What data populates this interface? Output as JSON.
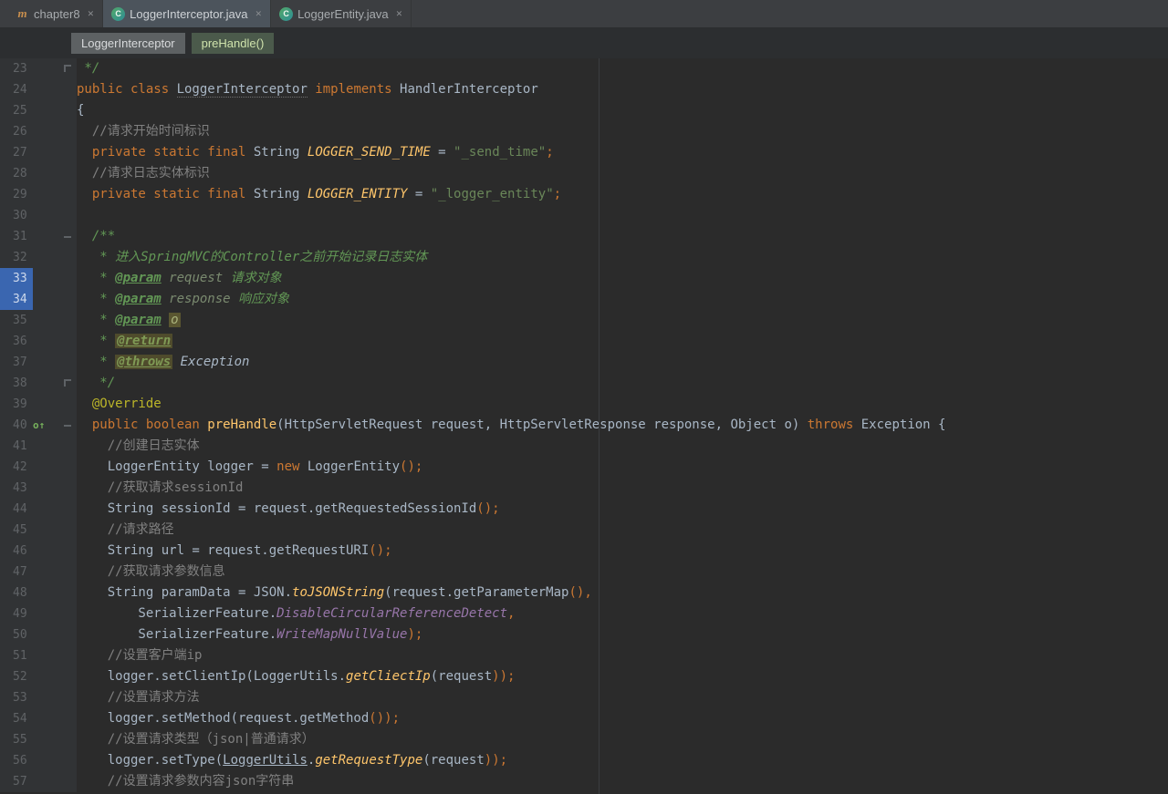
{
  "colors": {
    "editor_bg": "#2b2b2b",
    "gutter_bg": "#313335",
    "tabbar_bg": "#3c3e41",
    "selected_tab_bg": "#4c545c",
    "keyword": "#cc7832",
    "string": "#6a8759",
    "comment": "#808080",
    "javadoc": "#629755",
    "constant": "#ffc66b",
    "static_field": "#9876aa",
    "bookmark_blue": "#3a66b0"
  },
  "tabs": [
    {
      "label": "chapter8",
      "icon": "module",
      "selected": false,
      "close_icon": "x"
    },
    {
      "label": "LoggerInterceptor.java",
      "icon": "class",
      "selected": true,
      "close_icon": "x"
    },
    {
      "label": "LoggerEntity.java",
      "icon": "class",
      "selected": false,
      "close_icon": "x"
    }
  ],
  "breadcrumbs": [
    {
      "label": "LoggerInterceptor",
      "type": "class"
    },
    {
      "label": "preHandle()",
      "type": "method"
    }
  ],
  "editor": {
    "first_line": 23,
    "last_line": 57,
    "lines": [
      {
        "n": 23,
        "fold": "end",
        "seg": [
          [
            "d",
            " */"
          ]
        ]
      },
      {
        "n": 24,
        "seg": [
          [
            "k",
            "public class "
          ],
          [
            "spell",
            "LoggerInterceptor"
          ],
          [
            "k",
            " implements "
          ],
          [
            "p",
            "HandlerInterceptor"
          ]
        ]
      },
      {
        "n": 25,
        "seg": [
          [
            "p",
            "{"
          ]
        ]
      },
      {
        "n": 26,
        "seg": [
          [
            "c",
            "  //请求开始时间标识"
          ]
        ]
      },
      {
        "n": 27,
        "seg": [
          [
            "k",
            "  private static final "
          ],
          [
            "p",
            "String "
          ],
          [
            "cn",
            "LOGGER_SEND_TIME"
          ],
          [
            "p",
            " = "
          ],
          [
            "s",
            "\"_send_time\""
          ],
          [
            "pu",
            ";"
          ]
        ]
      },
      {
        "n": 28,
        "seg": [
          [
            "c",
            "  //请求日志实体标识"
          ]
        ]
      },
      {
        "n": 29,
        "seg": [
          [
            "k",
            "  private static final "
          ],
          [
            "p",
            "String "
          ],
          [
            "cn",
            "LOGGER_ENTITY"
          ],
          [
            "p",
            " = "
          ],
          [
            "s",
            "\"_logger_entity\""
          ],
          [
            "pu",
            ";"
          ]
        ]
      },
      {
        "n": 30,
        "seg": []
      },
      {
        "n": 31,
        "fold": "start",
        "seg": [
          [
            "d",
            "  /**"
          ]
        ]
      },
      {
        "n": 32,
        "seg": [
          [
            "d",
            "   * 进入SpringMVC的Controller之前开始记录日志实体"
          ]
        ]
      },
      {
        "n": 33,
        "mark": true,
        "seg": [
          [
            "d",
            "   * "
          ],
          [
            "dt",
            "@param"
          ],
          [
            "dv",
            " request "
          ],
          [
            "d",
            "请求对象"
          ]
        ]
      },
      {
        "n": 34,
        "mark": true,
        "seg": [
          [
            "d",
            "   * "
          ],
          [
            "dt",
            "@param"
          ],
          [
            "dv",
            " response "
          ],
          [
            "d",
            "响应对象"
          ]
        ]
      },
      {
        "n": 35,
        "seg": [
          [
            "d",
            "   * "
          ],
          [
            "dt",
            "@param"
          ],
          [
            "d",
            " "
          ],
          [
            "hl",
            "o"
          ]
        ]
      },
      {
        "n": 36,
        "seg": [
          [
            "d",
            "   * "
          ],
          [
            "dtbg",
            "@return"
          ]
        ]
      },
      {
        "n": 37,
        "seg": [
          [
            "d",
            "   * "
          ],
          [
            "dtbg",
            "@throws"
          ],
          [
            "dve",
            " Exception"
          ]
        ]
      },
      {
        "n": 38,
        "fold": "end",
        "seg": [
          [
            "d",
            "   */"
          ]
        ]
      },
      {
        "n": 39,
        "seg": [
          [
            "an",
            "  @Override"
          ]
        ]
      },
      {
        "n": 40,
        "fold": "start",
        "override": true,
        "seg": [
          [
            "k",
            "  public boolean "
          ],
          [
            "m",
            "preHandle"
          ],
          [
            "p",
            "(HttpServletRequest request, HttpServletResponse response, Object o) "
          ],
          [
            "k",
            "throws"
          ],
          [
            "p",
            " Exception {"
          ]
        ]
      },
      {
        "n": 41,
        "seg": [
          [
            "c",
            "    //创建日志实体"
          ]
        ]
      },
      {
        "n": 42,
        "seg": [
          [
            "p",
            "    LoggerEntity logger = "
          ],
          [
            "k",
            "new"
          ],
          [
            "p",
            " LoggerEntity"
          ],
          [
            "pu",
            "();"
          ]
        ]
      },
      {
        "n": 43,
        "seg": [
          [
            "c",
            "    //获取请求sessionId"
          ]
        ]
      },
      {
        "n": 44,
        "seg": [
          [
            "p",
            "    String sessionId = request.getRequestedSessionId"
          ],
          [
            "pu",
            "();"
          ]
        ]
      },
      {
        "n": 45,
        "seg": [
          [
            "c",
            "    //请求路径"
          ]
        ]
      },
      {
        "n": 46,
        "seg": [
          [
            "p",
            "    String url = request.getRequestURI"
          ],
          [
            "pu",
            "();"
          ]
        ]
      },
      {
        "n": 47,
        "seg": [
          [
            "c",
            "    //获取请求参数信息"
          ]
        ]
      },
      {
        "n": 48,
        "seg": [
          [
            "p",
            "    String paramData = JSON."
          ],
          [
            "sm",
            "toJSONString"
          ],
          [
            "p",
            "(request.getParameterMap"
          ],
          [
            "pu",
            "(),"
          ]
        ]
      },
      {
        "n": 49,
        "seg": [
          [
            "p",
            "        SerializerFeature."
          ],
          [
            "sf",
            "DisableCircularReferenceDetect"
          ],
          [
            "pu",
            ","
          ]
        ]
      },
      {
        "n": 50,
        "seg": [
          [
            "p",
            "        SerializerFeature."
          ],
          [
            "sf",
            "WriteMapNullValue"
          ],
          [
            "pu",
            ");"
          ]
        ]
      },
      {
        "n": 51,
        "seg": [
          [
            "c",
            "    //设置客户端ip"
          ]
        ]
      },
      {
        "n": 52,
        "seg": [
          [
            "p",
            "    logger.setClientIp(LoggerUtils."
          ],
          [
            "sm",
            "getCliectIp"
          ],
          [
            "p",
            "(request"
          ],
          [
            "pu",
            "));"
          ]
        ]
      },
      {
        "n": 53,
        "seg": [
          [
            "c",
            "    //设置请求方法"
          ]
        ]
      },
      {
        "n": 54,
        "seg": [
          [
            "p",
            "    logger.setMethod(request.getMethod"
          ],
          [
            "pu",
            "());"
          ]
        ]
      },
      {
        "n": 55,
        "seg": [
          [
            "c",
            "    //设置请求类型（json|普通请求）"
          ]
        ]
      },
      {
        "n": 56,
        "seg": [
          [
            "p",
            "    logger.setType("
          ],
          [
            "und",
            "LoggerUtils"
          ],
          [
            "p",
            "."
          ],
          [
            "sm",
            "getRequestType"
          ],
          [
            "p",
            "(request"
          ],
          [
            "pu",
            "));"
          ]
        ]
      },
      {
        "n": 57,
        "seg": [
          [
            "c",
            "    //设置请求参数内容json字符串"
          ]
        ]
      }
    ]
  }
}
